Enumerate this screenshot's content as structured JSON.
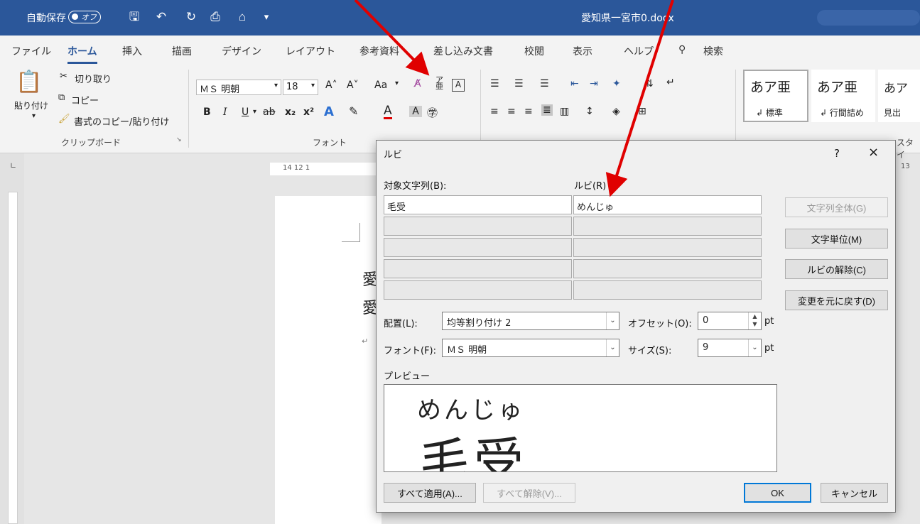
{
  "titlebar": {
    "autosave_label": "自動保存",
    "autosave_state": "オフ",
    "filename": "愛知県一宮市0.docx"
  },
  "tabs": [
    "ファイル",
    "ホーム",
    "挿入",
    "描画",
    "デザイン",
    "レイアウト",
    "参考資料",
    "差し込み文書",
    "校閲",
    "表示",
    "ヘルプ",
    "検索"
  ],
  "clipboard": {
    "paste": "貼り付け",
    "cut": "切り取り",
    "copy": "コピー",
    "format_painter": "書式のコピー/貼り付け",
    "group_label": "クリップボード"
  },
  "font": {
    "name": "ＭＳ 明朝",
    "size": "18",
    "aa": "Aa",
    "group_label": "フォント"
  },
  "styles": {
    "items": [
      {
        "sample": "あア亜",
        "label": "標準"
      },
      {
        "sample": "あア亜",
        "label": "行間詰め"
      },
      {
        "sample": "あア",
        "label": "見出"
      }
    ],
    "group_label_partial": "スタイ"
  },
  "ruler": {
    "h_ticks": "14  12  1",
    "h_right": "13"
  },
  "document": {
    "line1": "愛",
    "line2": "愛"
  },
  "dialog": {
    "title": "ルビ",
    "help": "?",
    "close": "×",
    "target_label": "対象文字列(B):",
    "ruby_label": "ルビ(R)",
    "rows": [
      {
        "base": "毛受",
        "ruby": "めんじゅ"
      },
      {
        "base": "",
        "ruby": ""
      },
      {
        "base": "",
        "ruby": ""
      },
      {
        "base": "",
        "ruby": ""
      },
      {
        "base": "",
        "ruby": ""
      }
    ],
    "buttons": {
      "whole": "文字列全体(G)",
      "per_char": "文字単位(M)",
      "remove": "ルビの解除(C)",
      "revert": "変更を元に戻す(D)",
      "apply_all": "すべて適用(A)...",
      "remove_all": "すべて解除(V)...",
      "ok": "OK",
      "cancel": "キャンセル"
    },
    "alignment_label": "配置(L):",
    "alignment_value": "均等割り付け 2",
    "offset_label": "オフセット(O):",
    "offset_value": "0",
    "offset_unit": "pt",
    "font_label": "フォント(F):",
    "font_value": "ＭＳ 明朝",
    "size_label": "サイズ(S):",
    "size_value": "9",
    "size_unit": "pt",
    "preview_label": "プレビュー",
    "preview_ruby": "めんじゅ",
    "preview_base": "毛受"
  },
  "colors": {
    "titlebar": "#2b579a",
    "annotation_arrow": "#e00000",
    "ok_border": "#0078d7"
  }
}
